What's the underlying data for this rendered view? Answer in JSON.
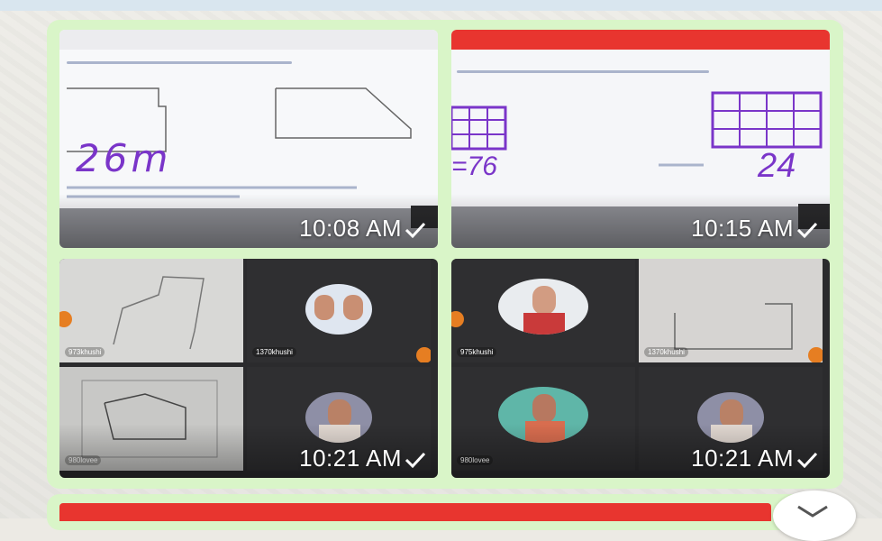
{
  "messages": [
    {
      "time": "10:08 AM",
      "handwriting": "26m"
    },
    {
      "time": "10:15 AM",
      "handwriting_left": "=76",
      "handwriting_right": "24"
    },
    {
      "time": "10:21 AM",
      "participants": [
        "973khushi",
        "1370khushi",
        "980lovee"
      ]
    },
    {
      "time": "10:21 AM",
      "participants": [
        "975khushi",
        "1370khushi",
        "980lovee"
      ]
    }
  ],
  "colors": {
    "bubble": "#d9f5c8",
    "header_red": "#e8352f",
    "ink": "#7a35c9"
  },
  "icons": {
    "status": "check-icon",
    "scroll": "chevron-down-icon"
  }
}
